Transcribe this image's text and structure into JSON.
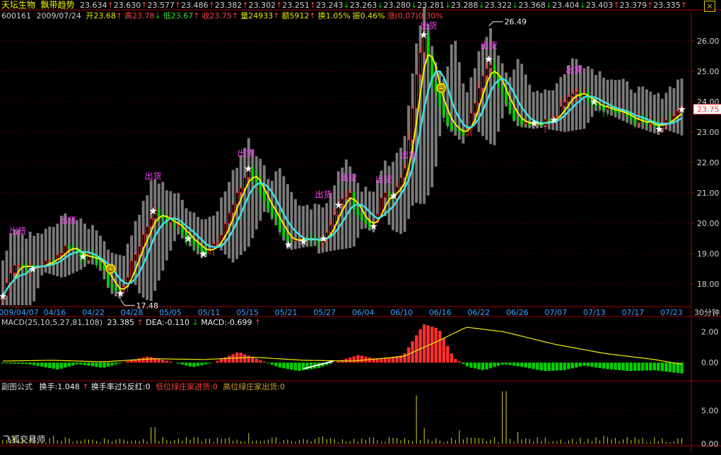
{
  "stock": {
    "name": "天坛生物",
    "indicator": "飘带趋势",
    "code": "600161",
    "date": "2009/07/24"
  },
  "ticker_prices": [
    {
      "v": "23.634",
      "d": "up"
    },
    {
      "v": "23.630",
      "d": "up"
    },
    {
      "v": "23.577",
      "d": "up"
    },
    {
      "v": "23.486",
      "d": "up"
    },
    {
      "v": "23.382",
      "d": "up"
    },
    {
      "v": "23.302",
      "d": "up"
    },
    {
      "v": "23.251",
      "d": "up"
    },
    {
      "v": "23.243",
      "d": "down"
    },
    {
      "v": "23.263",
      "d": "down"
    },
    {
      "v": "23.280",
      "d": "down"
    },
    {
      "v": "23.281",
      "d": "down"
    },
    {
      "v": "23.288",
      "d": "down"
    },
    {
      "v": "23.322",
      "d": "down"
    },
    {
      "v": "23.368",
      "d": "down"
    },
    {
      "v": "23.404",
      "d": "down"
    },
    {
      "v": "23.403",
      "d": "up"
    },
    {
      "v": "23.379",
      "d": "up"
    },
    {
      "v": "23.335",
      "d": "up"
    }
  ],
  "quote": [
    {
      "label": "开",
      "value": "23.68",
      "color": "#e8e800",
      "arrow": "up"
    },
    {
      "label": "高",
      "value": "23.78",
      "color": "#ff4040",
      "arrow": "down"
    },
    {
      "label": "低",
      "value": "23.67",
      "color": "#30e030",
      "arrow": "up"
    },
    {
      "label": "收",
      "value": "23.75",
      "color": "#ff4040",
      "arrow": "up"
    },
    {
      "label": "量",
      "value": "24933",
      "color": "#e8e800",
      "arrow": "up"
    },
    {
      "label": "额",
      "value": "5912",
      "color": "#e8e800",
      "arrow": "up"
    },
    {
      "label": "换",
      "value": "1.05%",
      "color": "#e8e800",
      "arrow": ""
    },
    {
      "label": "振",
      "value": "0.46%",
      "color": "#e8e800",
      "arrow": ""
    },
    {
      "label": "涨",
      "value": "(0.07)0.30%",
      "color": "#ff4040",
      "arrow": ""
    }
  ],
  "macd_header": {
    "text": "MACD(25,10,5,27,81,108)",
    "macd_val": "23.385",
    "dea": "DEA:-0.110",
    "macd": "MACD:-0.699"
  },
  "sub_header": {
    "title": "副图公式",
    "turnover": "换手:1.048",
    "t5": "换手率过5反红:0",
    "low": "低位绿庄家进货:0",
    "high": "高位绿庄家出货:0"
  },
  "timeframe": "30分钟",
  "brand": "飞狐交易师",
  "current_price": "23.75",
  "signal_label": "出货",
  "colors": {
    "up": "#ff3030",
    "down": "#00d000",
    "ma_yellow": "#f0f000",
    "ma_cyan": "#40e0e0",
    "band": "#909090",
    "grid": "#7a0000",
    "axis": "#a00000",
    "tick": "#d0d0d0",
    "magenta": "#ff40ff",
    "volume": "#d8d820",
    "date": "#40a0ff"
  },
  "chart_data": [
    {
      "type": "candlestick",
      "name": "main",
      "ylim": [
        17.3,
        26.6
      ],
      "yticks": [
        "18.00",
        "19.00",
        "20.00",
        "21.00",
        "22.00",
        "23.00",
        "24.00",
        "25.00",
        "26.00"
      ],
      "x_ticks": [
        "2009/04/07",
        "04/16",
        "04/22",
        "04/28",
        "05/05",
        "05/11",
        "05/15",
        "05/21",
        "05/27",
        "06/04",
        "06/10",
        "06/16",
        "06/22",
        "06/26",
        "07/07",
        "07/13",
        "07/17",
        "07/23"
      ],
      "bar_count": 175,
      "anchors": [
        [
          0,
          17.6
        ],
        [
          4,
          18.7
        ],
        [
          12,
          18.5
        ],
        [
          20,
          18.8
        ],
        [
          26,
          19.3
        ],
        [
          32,
          18.9
        ],
        [
          38,
          18.8
        ],
        [
          43,
          17.9
        ],
        [
          47,
          17.7
        ],
        [
          54,
          19.2
        ],
        [
          60,
          20.4
        ],
        [
          68,
          20.0
        ],
        [
          74,
          19.5
        ],
        [
          80,
          19.0
        ],
        [
          86,
          19.5
        ],
        [
          92,
          20.6
        ],
        [
          98,
          21.8
        ],
        [
          104,
          20.8
        ],
        [
          110,
          20.0
        ],
        [
          114,
          19.3
        ],
        [
          120,
          19.4
        ],
        [
          128,
          19.5
        ],
        [
          134,
          20.6
        ],
        [
          138,
          21.0
        ],
        [
          143,
          20.1
        ],
        [
          148,
          19.9
        ],
        [
          152,
          21.0
        ],
        [
          156,
          20.9
        ],
        [
          160,
          21.6
        ],
        [
          165,
          24.8
        ],
        [
          168,
          26.2
        ],
        [
          172,
          24.4
        ],
        [
          178,
          23.3
        ],
        [
          184,
          22.8
        ],
        [
          190,
          24.5
        ],
        [
          194,
          25.4
        ],
        [
          198,
          24.5
        ],
        [
          205,
          23.4
        ],
        [
          212,
          23.3
        ],
        [
          220,
          23.4
        ],
        [
          228,
          24.4
        ],
        [
          236,
          24.0
        ],
        [
          244,
          23.7
        ],
        [
          252,
          23.4
        ],
        [
          262,
          23.1
        ],
        [
          271,
          23.75
        ]
      ],
      "annotations": [
        {
          "text": "出货",
          "x": 6,
          "y": 19.65
        },
        {
          "text": "出货",
          "x": 26,
          "y": 20.0
        },
        {
          "text": "出货",
          "x": 60,
          "y": 21.45
        },
        {
          "text": "出货",
          "x": 97,
          "y": 22.2
        },
        {
          "text": "出货",
          "x": 128,
          "y": 20.85
        },
        {
          "text": "出货",
          "x": 138,
          "y": 21.4
        },
        {
          "text": "出货",
          "x": 152,
          "y": 21.35
        },
        {
          "text": "出货",
          "x": 162,
          "y": 22.15
        },
        {
          "text": "出货",
          "x": 170,
          "y": 26.4
        },
        {
          "text": "出货",
          "x": 194,
          "y": 25.75
        },
        {
          "text": "出货",
          "x": 228,
          "y": 24.95
        }
      ],
      "price_labels": [
        {
          "text": "26.49",
          "x": 194,
          "y": 26.49
        },
        {
          "text": "17.48",
          "x": 47,
          "y": 17.48
        }
      ],
      "star_x": [
        0,
        12,
        32,
        47,
        60,
        74,
        80,
        98,
        114,
        120,
        128,
        134,
        148,
        156,
        168,
        194,
        212,
        220,
        236,
        262,
        271
      ],
      "smiley_x": [
        43,
        175
      ]
    },
    {
      "type": "bar",
      "name": "MACD",
      "ylim": [
        -0.45,
        2.35
      ],
      "yticks": [
        "2.00",
        "0.00"
      ],
      "hist_anchors": [
        [
          0,
          -0.05
        ],
        [
          10,
          -0.1
        ],
        [
          22,
          -0.45
        ],
        [
          30,
          -0.1
        ],
        [
          40,
          -0.35
        ],
        [
          50,
          0.1
        ],
        [
          58,
          0.4
        ],
        [
          66,
          0.1
        ],
        [
          76,
          -0.3
        ],
        [
          84,
          0.0
        ],
        [
          94,
          0.7
        ],
        [
          102,
          0.2
        ],
        [
          110,
          -0.3
        ],
        [
          118,
          -0.55
        ],
        [
          126,
          -0.35
        ],
        [
          134,
          0.1
        ],
        [
          142,
          0.5
        ],
        [
          150,
          0.2
        ],
        [
          160,
          0.5
        ],
        [
          168,
          2.5
        ],
        [
          174,
          2.2
        ],
        [
          180,
          0.3
        ],
        [
          186,
          -0.3
        ],
        [
          192,
          -0.5
        ],
        [
          200,
          -0.1
        ],
        [
          208,
          -0.3
        ],
        [
          216,
          -0.55
        ],
        [
          224,
          -0.5
        ],
        [
          232,
          -0.2
        ],
        [
          240,
          -0.4
        ],
        [
          250,
          -0.55
        ],
        [
          260,
          -0.5
        ],
        [
          271,
          -0.7
        ]
      ],
      "line_anchors": [
        [
          0,
          0.1
        ],
        [
          20,
          0.15
        ],
        [
          40,
          0.05
        ],
        [
          60,
          0.25
        ],
        [
          80,
          0.2
        ],
        [
          100,
          0.35
        ],
        [
          120,
          0.15
        ],
        [
          140,
          0.1
        ],
        [
          160,
          0.4
        ],
        [
          175,
          1.5
        ],
        [
          185,
          2.3
        ],
        [
          200,
          2.0
        ],
        [
          220,
          1.2
        ],
        [
          240,
          0.6
        ],
        [
          260,
          0.2
        ],
        [
          271,
          -0.11
        ]
      ]
    },
    {
      "type": "bar",
      "name": "换手",
      "ylim": [
        0,
        8.0
      ],
      "yticks": [
        "5.00",
        "0.00"
      ],
      "spikes": [
        [
          20,
          1.2
        ],
        [
          60,
          2.5
        ],
        [
          98,
          1.6
        ],
        [
          128,
          1.1
        ],
        [
          165,
          7.3
        ],
        [
          168,
          2.4
        ],
        [
          182,
          2.0
        ],
        [
          200,
          7.9
        ],
        [
          205,
          1.8
        ],
        [
          240,
          1.2
        ]
      ]
    }
  ]
}
